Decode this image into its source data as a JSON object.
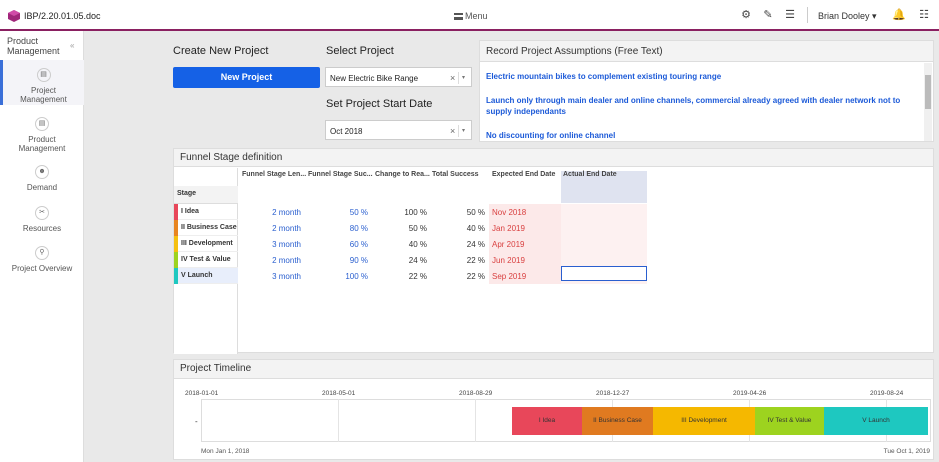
{
  "topbar": {
    "doc_title": "IBP/2.20.01.05.doc",
    "menu_label": "Menu",
    "user_name": "Brian Dooley",
    "accent": "#8a2061",
    "icons": [
      "gear-icon",
      "pencil-icon",
      "list-icon",
      "bell-icon",
      "settings-menu-icon"
    ]
  },
  "sidebar": {
    "title": "Product Management",
    "collapse": "«",
    "items": [
      {
        "label": "Project Management",
        "icon": "document-icon",
        "active": true
      },
      {
        "label": "Product Management",
        "icon": "document-icon",
        "active": false
      },
      {
        "label": "Demand",
        "icon": "people-icon",
        "active": false
      },
      {
        "label": "Resources",
        "icon": "tools-icon",
        "active": false
      },
      {
        "label": "Project Overview",
        "icon": "magnifier-icon",
        "active": false
      }
    ]
  },
  "create": {
    "heading": "Create New Project",
    "button": "New Project"
  },
  "select_project": {
    "heading": "Select Project",
    "value": "New Electric Bike Range",
    "clear": "×",
    "caret": "▾"
  },
  "start_date": {
    "heading": "Set Project Start Date",
    "value": "Oct 2018",
    "clear": "×",
    "caret": "▾"
  },
  "assumptions": {
    "heading": "Record Project Assumptions (Free Text)",
    "lines": [
      "Electric mountain bikes to complement existing touring range",
      "Launch only through main dealer and online channels, commercial already agreed with dealer network not to supply independants",
      "No discounting for online channel"
    ]
  },
  "funnel": {
    "heading": "Funnel Stage definition",
    "columns": [
      "Funnel Stage Len...",
      "Funnel Stage Suc...",
      "Change to Rea...",
      "Total Success",
      "Expected End Date",
      "Actual End Date"
    ],
    "stage_header": "Stage",
    "rows": [
      {
        "stage": "I Idea",
        "length": "2 month",
        "success": "50 %",
        "change": "100 %",
        "total": "50 %",
        "expected": "Nov 2018",
        "color": "#e8475a"
      },
      {
        "stage": "II Business Case",
        "length": "2 month",
        "success": "80 %",
        "change": "50 %",
        "total": "40 %",
        "expected": "Jan 2019",
        "color": "#e88520"
      },
      {
        "stage": "III Development",
        "length": "3 month",
        "success": "60 %",
        "change": "40 %",
        "total": "24 %",
        "expected": "Apr 2019",
        "color": "#f5c010"
      },
      {
        "stage": "IV Test & Value",
        "length": "2 month",
        "success": "90 %",
        "change": "24 %",
        "total": "22 %",
        "expected": "Jun 2019",
        "color": "#9dd31f"
      },
      {
        "stage": "V Launch",
        "length": "3 month",
        "success": "100 %",
        "change": "22 %",
        "total": "22 %",
        "expected": "Sep 2019",
        "color": "#1ec8c0"
      }
    ]
  },
  "timeline": {
    "heading": "Project Timeline",
    "ticks": [
      "2018-01-01",
      "2018-05-01",
      "2018-08-29",
      "2018-12-27",
      "2019-04-26",
      "2019-08-24"
    ],
    "row_label": "-",
    "start_label": "Mon Jan 1, 2018",
    "end_label": "Tue Oct 1, 2019",
    "bars": [
      {
        "label": "I Idea",
        "color": "#e8475a"
      },
      {
        "label": "II Business Case",
        "color": "#e07a20"
      },
      {
        "label": "III Development",
        "color": "#f5b800"
      },
      {
        "label": "IV Test & Value",
        "color": "#9dd31f"
      },
      {
        "label": "V Launch",
        "color": "#1ec8c0"
      }
    ]
  }
}
